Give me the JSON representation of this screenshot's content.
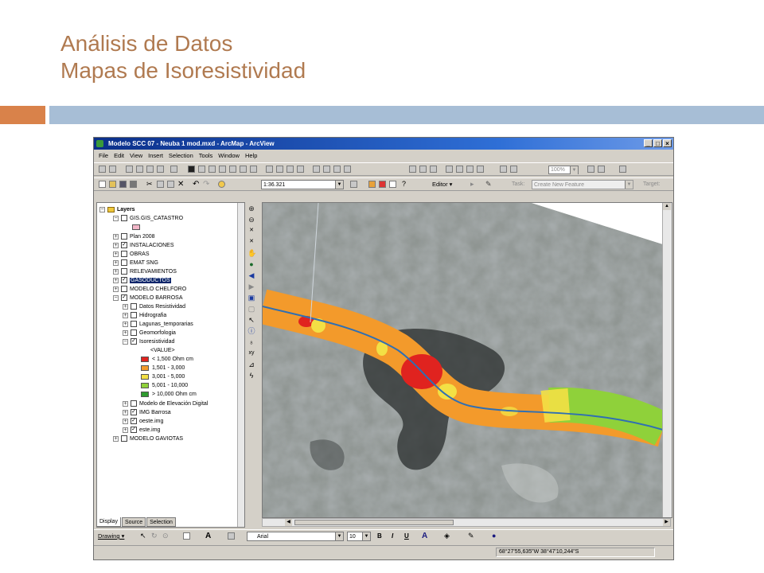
{
  "slide": {
    "title_line1": "Análisis de Datos",
    "title_line2": "Mapas de Isoresistividad",
    "accent_orange": "#d9824a",
    "accent_blue": "#a7bed6",
    "title_color": "#b07a50"
  },
  "window": {
    "title": "Modelo SCC 07 - Neuba 1 mod.mxd - ArcMap - ArcView",
    "buttons": [
      "_",
      "□",
      "×"
    ]
  },
  "menu": [
    "File",
    "Edit",
    "View",
    "Insert",
    "Selection",
    "Tools",
    "Window",
    "Help"
  ],
  "toolbar": {
    "scale": "1:36.321",
    "editor": "Editor ▾",
    "task_label": "Task:",
    "task_value": "Create New Feature",
    "target_label": "Target:",
    "zoom": "100%"
  },
  "toc": {
    "root": "Layers",
    "items": [
      {
        "label": "GIS.GIS_CATASTRO",
        "checked": false,
        "expanded": true
      },
      {
        "label": "Plan 2008",
        "checked": false
      },
      {
        "label": "INSTALACIONES",
        "checked": true
      },
      {
        "label": "OBRAS",
        "checked": false
      },
      {
        "label": "EMAT SNG",
        "checked": false
      },
      {
        "label": "RELEVAMIENTOS",
        "checked": false
      },
      {
        "label": "GASODUCTOS",
        "checked": true,
        "selected": true
      },
      {
        "label": "MODELO CHELFORO",
        "checked": false
      },
      {
        "label": "MODELO BARROSA",
        "checked": true,
        "expanded": true
      },
      {
        "label": "Datos Resistividad",
        "checked": false
      },
      {
        "label": "Hidrografia",
        "checked": false
      },
      {
        "label": "Lagunas_temporarias",
        "checked": false
      },
      {
        "label": "Geomorfologia",
        "checked": false
      },
      {
        "label": "Isoresistividad",
        "checked": true,
        "expanded": true
      },
      {
        "label": "Modelo de Elevación Digital",
        "checked": false
      },
      {
        "label": "IMG Barrosa",
        "checked": true
      },
      {
        "label": "oeste.img",
        "checked": true
      },
      {
        "label": "este.img",
        "checked": true
      },
      {
        "label": "MODELO GAVIOTAS",
        "checked": false
      }
    ],
    "legend_field": "<VALUE>",
    "legend": [
      {
        "label": "< 1,500 Ohm cm",
        "color": "#e0231f"
      },
      {
        "label": "1,501 - 3,000",
        "color": "#f39a2b"
      },
      {
        "label": "3,001 - 5,000",
        "color": "#f3e045"
      },
      {
        "label": "5,001 - 10,000",
        "color": "#8fd13a"
      },
      {
        "label": "> 10,000 Ohm cm",
        "color": "#2e9a2e"
      }
    ],
    "tabs": [
      "Display",
      "Source",
      "Selection"
    ]
  },
  "drawing": {
    "label": "Drawing ▾",
    "font": "Arial",
    "size": "10",
    "bold": "B",
    "italic": "I",
    "underline": "U"
  },
  "status": {
    "coords": "68°27'55,635\"W  38°47'10,244\"S"
  },
  "icons": {
    "vertical_tools": [
      "zoom-in-icon",
      "zoom-out-icon",
      "fixed-zoom-in-icon",
      "fixed-zoom-out-icon",
      "pan-icon",
      "full-extent-icon",
      "back-icon",
      "forward-icon",
      "select-features-icon",
      "clear-selection-icon",
      "select-elements-icon",
      "identify-icon",
      "find-icon",
      "measure-icon",
      "go-to-xy-icon",
      "hyperlink-icon"
    ]
  }
}
